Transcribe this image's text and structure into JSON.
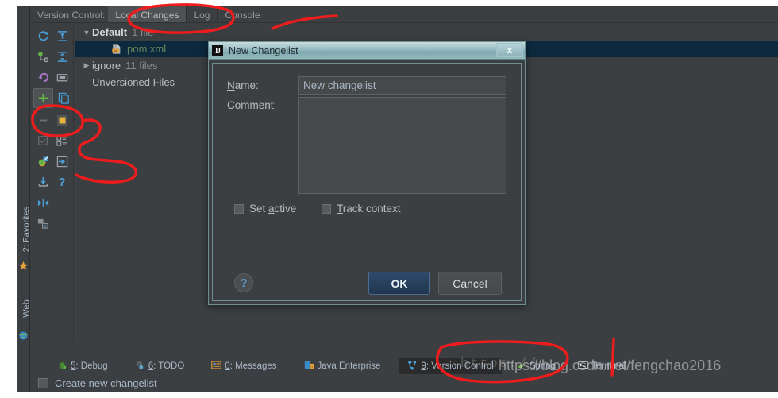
{
  "window": {
    "tool_window_title": "Version Control:",
    "tabs": [
      {
        "label": "Local Changes",
        "active": true
      },
      {
        "label": "Log",
        "active": false
      },
      {
        "label": "Console",
        "active": false
      }
    ]
  },
  "left_tool_bar": {
    "items": [
      {
        "label": "2: Favorites",
        "mnemonic": "2",
        "icon": "star-icon"
      },
      {
        "label": "Web",
        "icon": "globe-icon"
      }
    ]
  },
  "toolbar_icons": [
    {
      "name": "refresh-icon",
      "glyph": "↺",
      "color": "#4a9fd8",
      "selected": false
    },
    {
      "name": "expand-all-icon",
      "glyph": "↧",
      "color": "#4a9fd8",
      "selected": false
    },
    {
      "name": "commit-icon",
      "glyph": "⚲",
      "color": "#62b543",
      "selected": false
    },
    {
      "name": "collapse-all-icon",
      "glyph": "↥",
      "color": "#4a9fd8",
      "selected": false
    },
    {
      "name": "rollback-icon",
      "glyph": "↶",
      "color": "#b07ad0",
      "selected": false
    },
    {
      "name": "show-diff-folder-icon",
      "glyph": "▭",
      "color": "#9aa0a6",
      "selected": false
    },
    {
      "name": "new-changelist-icon",
      "glyph": "+",
      "color": "#62b543",
      "selected": true
    },
    {
      "name": "move-to-changelist-icon",
      "glyph": "⧉",
      "color": "#4a9fd8",
      "selected": false
    },
    {
      "name": "delete-changelist-icon",
      "glyph": "—",
      "color": "#6c7073",
      "selected": false
    },
    {
      "name": "set-active-changelist-icon",
      "glyph": "▣",
      "color": "#e8b33a",
      "selected": false
    },
    {
      "name": "toggle-checkbox-icon",
      "glyph": "☑",
      "color": "#6c7073",
      "selected": false
    },
    {
      "name": "group-by-icon",
      "glyph": "≣",
      "color": "#9aa0a6",
      "selected": false
    },
    {
      "name": "open-in-editor-icon",
      "glyph": "◑",
      "color": "#62b543",
      "selected": false
    },
    {
      "name": "shelve-silently-icon",
      "glyph": "⇥",
      "color": "#4a9fd8",
      "selected": false
    },
    {
      "name": "update-project-icon",
      "glyph": "⤓",
      "color": "#4a9fd8",
      "selected": false
    },
    {
      "name": "help-icon",
      "glyph": "?",
      "color": "#4a9fd8",
      "selected": false
    },
    {
      "name": "collapse-icon",
      "glyph": "⇤",
      "color": "#4a9fd8",
      "selected": false
    },
    {
      "name": "group-changes-icon",
      "glyph": "❐",
      "color": "#9aa0a6",
      "selected": false
    }
  ],
  "changes_tree": [
    {
      "indent": 0,
      "arrow": "▼",
      "name": "Default",
      "count": "1 file",
      "type": "changelist",
      "selected": false
    },
    {
      "indent": 1,
      "arrow": "",
      "name": "pom.xml",
      "count": "",
      "type": "file",
      "selected": true,
      "icon": "xml-file-icon"
    },
    {
      "indent": 0,
      "arrow": "▶",
      "name": "ignore",
      "count": "11 files",
      "type": "changelist-plain",
      "selected": false
    },
    {
      "indent": 0,
      "arrow": "",
      "name": "Unversioned Files",
      "count": "",
      "type": "changelist-plain",
      "selected": false
    }
  ],
  "dialog": {
    "title": "New Changelist",
    "app_icon_text": "IJ",
    "close_label": "x",
    "name_label": "Name:",
    "name_mnemonic": "N",
    "name_value": "New changelist",
    "comment_label": "Comment:",
    "comment_mnemonic": "C",
    "comment_value": "",
    "checkboxes": [
      {
        "label_pre": "Set ",
        "mnemonic": "a",
        "label_post": "ctive",
        "checked": false,
        "name": "set-active-checkbox"
      },
      {
        "label_pre": "",
        "mnemonic": "T",
        "label_post": "rack context",
        "checked": false,
        "name": "track-context-checkbox"
      }
    ],
    "help_label": "?",
    "ok_label": "OK",
    "cancel_label": "Cancel"
  },
  "status_bar": {
    "items": [
      {
        "label_pre": "",
        "mnemonic": "5",
        "label_post": ": Debug",
        "icon": "bug-icon",
        "active": false,
        "name": "statusbar-debug"
      },
      {
        "label_pre": "",
        "mnemonic": "6",
        "label_post": ": TODO",
        "icon": "todo-icon",
        "active": false,
        "name": "statusbar-todo"
      },
      {
        "label_pre": "",
        "mnemonic": "0",
        "label_post": ": Messages",
        "icon": "messages-icon",
        "active": false,
        "name": "statusbar-messages"
      },
      {
        "label_pre": "",
        "mnemonic": "",
        "label_post": "Java Enterprise",
        "icon": "java-enterprise-icon",
        "active": false,
        "name": "statusbar-java-enterprise"
      },
      {
        "label_pre": "",
        "mnemonic": "9",
        "label_post": ": Version Control",
        "icon": "vcs-icon",
        "active": true,
        "name": "statusbar-version-control"
      },
      {
        "label_pre": "",
        "mnemonic": "",
        "label_post": "Spring",
        "icon": "spring-icon",
        "active": false,
        "name": "statusbar-spring"
      },
      {
        "label_pre": "",
        "mnemonic": "",
        "label_post": "Terminal",
        "icon": "terminal-icon",
        "active": false,
        "name": "statusbar-terminal"
      }
    ]
  },
  "bottom_bar": {
    "message": "Create new changelist",
    "icon": "changelist-icon"
  },
  "watermark": {
    "primary": "https://blog.csdn.net/fengchao2016",
    "secondary": "https://"
  },
  "colors": {
    "ide_background": "#3c3f41",
    "selection": "#0d293e",
    "accent_green": "#62b543",
    "accent_blue": "#4a9fd8",
    "annotation_red": "#ee1c1c",
    "dialog_border": "#6d8f92"
  }
}
